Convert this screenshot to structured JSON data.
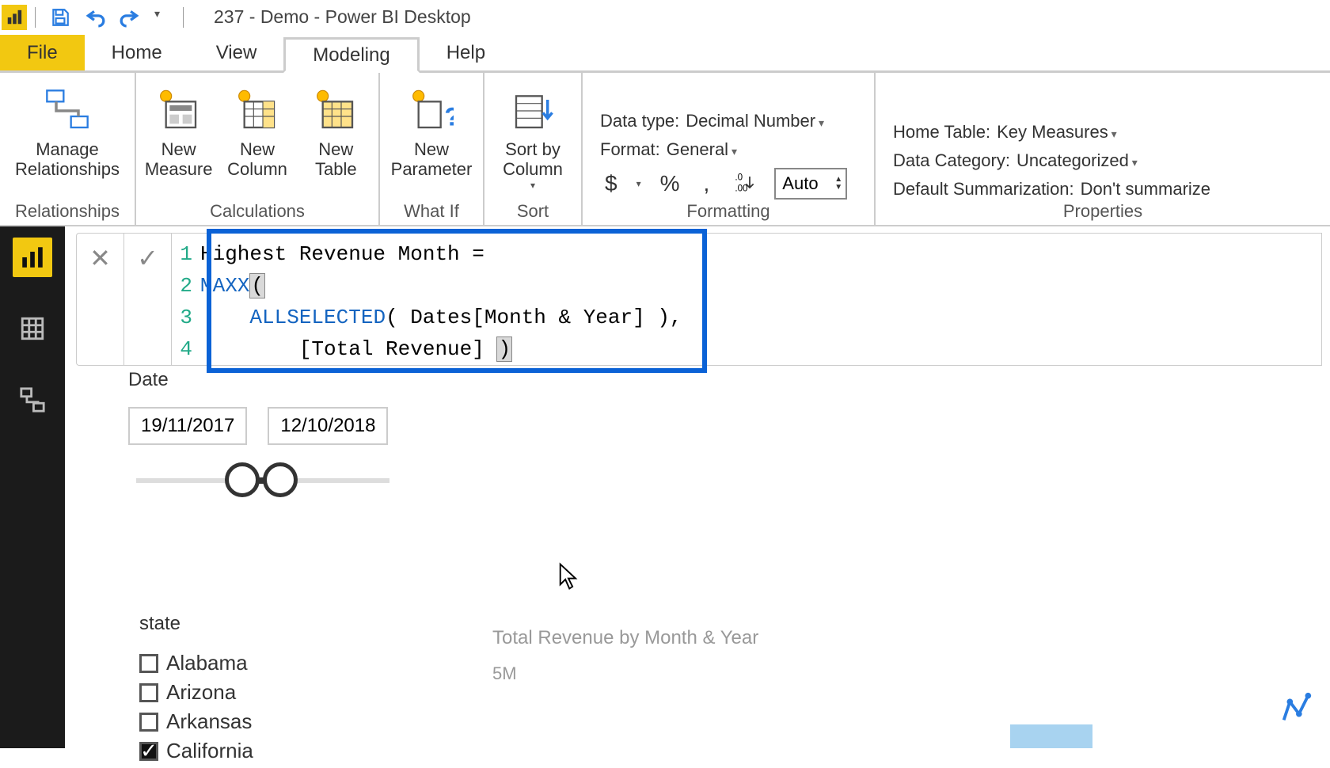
{
  "title": "237 - Demo - Power BI Desktop",
  "tabs": {
    "file": "File",
    "home": "Home",
    "view": "View",
    "modeling": "Modeling",
    "help": "Help"
  },
  "ribbon": {
    "relationships": {
      "manage": "Manage\nRelationships",
      "group": "Relationships"
    },
    "calculations": {
      "measure": "New\nMeasure",
      "column": "New\nColumn",
      "table": "New\nTable",
      "group": "Calculations"
    },
    "whatif": {
      "param": "New\nParameter",
      "group": "What If"
    },
    "sort": {
      "sortby": "Sort by\nColumn",
      "group": "Sort"
    },
    "formatting": {
      "datatype_label": "Data type:",
      "datatype_value": "Decimal Number",
      "format_label": "Format:",
      "format_value": "General",
      "currency": "$",
      "percent": "%",
      "comma": ",",
      "decimals_icon": ".00",
      "decimals_value": "Auto",
      "group": "Formatting"
    },
    "properties": {
      "hometable_label": "Home Table:",
      "hometable_value": "Key Measures",
      "category_label": "Data Category:",
      "category_value": "Uncategorized",
      "sum_label": "Default Summarization:",
      "sum_value": "Don't summarize",
      "group": "Properties"
    }
  },
  "formula": {
    "lines": [
      {
        "n": "1",
        "pre": "",
        "kw": "",
        "rest": "Highest Revenue Month ="
      },
      {
        "n": "2",
        "pre": "",
        "kw": "MAXX",
        "rest": "("
      },
      {
        "n": "3",
        "pre": "    ",
        "kw": "ALLSELECTED",
        "rest": "( Dates[Month & Year] ),"
      },
      {
        "n": "4",
        "pre": "        ",
        "kw": "",
        "rest": "[Total Revenue] )"
      }
    ]
  },
  "date_slicer": {
    "title": "Date",
    "start": "19/11/2017",
    "end": "12/10/2018"
  },
  "state_slicer": {
    "title": "state",
    "items": [
      {
        "label": "Alabama",
        "checked": false
      },
      {
        "label": "Arizona",
        "checked": false
      },
      {
        "label": "Arkansas",
        "checked": false
      },
      {
        "label": "California",
        "checked": true
      }
    ]
  },
  "chart": {
    "title": "Total Revenue by Month & Year",
    "ytick": "5M"
  }
}
